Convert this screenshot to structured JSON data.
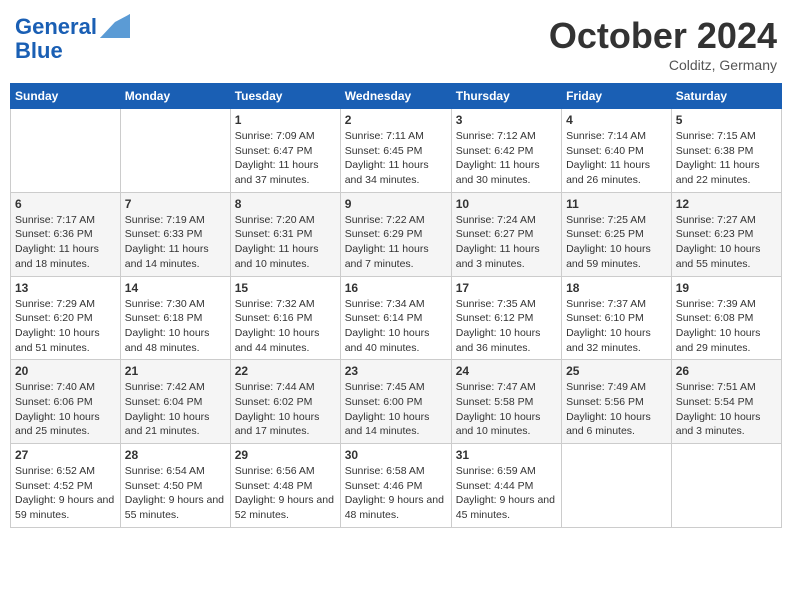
{
  "header": {
    "logo_line1": "General",
    "logo_line2": "Blue",
    "month": "October 2024",
    "location": "Colditz, Germany"
  },
  "weekdays": [
    "Sunday",
    "Monday",
    "Tuesday",
    "Wednesday",
    "Thursday",
    "Friday",
    "Saturday"
  ],
  "weeks": [
    [
      {
        "day": "",
        "info": ""
      },
      {
        "day": "",
        "info": ""
      },
      {
        "day": "1",
        "info": "Sunrise: 7:09 AM\nSunset: 6:47 PM\nDaylight: 11 hours and 37 minutes."
      },
      {
        "day": "2",
        "info": "Sunrise: 7:11 AM\nSunset: 6:45 PM\nDaylight: 11 hours and 34 minutes."
      },
      {
        "day": "3",
        "info": "Sunrise: 7:12 AM\nSunset: 6:42 PM\nDaylight: 11 hours and 30 minutes."
      },
      {
        "day": "4",
        "info": "Sunrise: 7:14 AM\nSunset: 6:40 PM\nDaylight: 11 hours and 26 minutes."
      },
      {
        "day": "5",
        "info": "Sunrise: 7:15 AM\nSunset: 6:38 PM\nDaylight: 11 hours and 22 minutes."
      }
    ],
    [
      {
        "day": "6",
        "info": "Sunrise: 7:17 AM\nSunset: 6:36 PM\nDaylight: 11 hours and 18 minutes."
      },
      {
        "day": "7",
        "info": "Sunrise: 7:19 AM\nSunset: 6:33 PM\nDaylight: 11 hours and 14 minutes."
      },
      {
        "day": "8",
        "info": "Sunrise: 7:20 AM\nSunset: 6:31 PM\nDaylight: 11 hours and 10 minutes."
      },
      {
        "day": "9",
        "info": "Sunrise: 7:22 AM\nSunset: 6:29 PM\nDaylight: 11 hours and 7 minutes."
      },
      {
        "day": "10",
        "info": "Sunrise: 7:24 AM\nSunset: 6:27 PM\nDaylight: 11 hours and 3 minutes."
      },
      {
        "day": "11",
        "info": "Sunrise: 7:25 AM\nSunset: 6:25 PM\nDaylight: 10 hours and 59 minutes."
      },
      {
        "day": "12",
        "info": "Sunrise: 7:27 AM\nSunset: 6:23 PM\nDaylight: 10 hours and 55 minutes."
      }
    ],
    [
      {
        "day": "13",
        "info": "Sunrise: 7:29 AM\nSunset: 6:20 PM\nDaylight: 10 hours and 51 minutes."
      },
      {
        "day": "14",
        "info": "Sunrise: 7:30 AM\nSunset: 6:18 PM\nDaylight: 10 hours and 48 minutes."
      },
      {
        "day": "15",
        "info": "Sunrise: 7:32 AM\nSunset: 6:16 PM\nDaylight: 10 hours and 44 minutes."
      },
      {
        "day": "16",
        "info": "Sunrise: 7:34 AM\nSunset: 6:14 PM\nDaylight: 10 hours and 40 minutes."
      },
      {
        "day": "17",
        "info": "Sunrise: 7:35 AM\nSunset: 6:12 PM\nDaylight: 10 hours and 36 minutes."
      },
      {
        "day": "18",
        "info": "Sunrise: 7:37 AM\nSunset: 6:10 PM\nDaylight: 10 hours and 32 minutes."
      },
      {
        "day": "19",
        "info": "Sunrise: 7:39 AM\nSunset: 6:08 PM\nDaylight: 10 hours and 29 minutes."
      }
    ],
    [
      {
        "day": "20",
        "info": "Sunrise: 7:40 AM\nSunset: 6:06 PM\nDaylight: 10 hours and 25 minutes."
      },
      {
        "day": "21",
        "info": "Sunrise: 7:42 AM\nSunset: 6:04 PM\nDaylight: 10 hours and 21 minutes."
      },
      {
        "day": "22",
        "info": "Sunrise: 7:44 AM\nSunset: 6:02 PM\nDaylight: 10 hours and 17 minutes."
      },
      {
        "day": "23",
        "info": "Sunrise: 7:45 AM\nSunset: 6:00 PM\nDaylight: 10 hours and 14 minutes."
      },
      {
        "day": "24",
        "info": "Sunrise: 7:47 AM\nSunset: 5:58 PM\nDaylight: 10 hours and 10 minutes."
      },
      {
        "day": "25",
        "info": "Sunrise: 7:49 AM\nSunset: 5:56 PM\nDaylight: 10 hours and 6 minutes."
      },
      {
        "day": "26",
        "info": "Sunrise: 7:51 AM\nSunset: 5:54 PM\nDaylight: 10 hours and 3 minutes."
      }
    ],
    [
      {
        "day": "27",
        "info": "Sunrise: 6:52 AM\nSunset: 4:52 PM\nDaylight: 9 hours and 59 minutes."
      },
      {
        "day": "28",
        "info": "Sunrise: 6:54 AM\nSunset: 4:50 PM\nDaylight: 9 hours and 55 minutes."
      },
      {
        "day": "29",
        "info": "Sunrise: 6:56 AM\nSunset: 4:48 PM\nDaylight: 9 hours and 52 minutes."
      },
      {
        "day": "30",
        "info": "Sunrise: 6:58 AM\nSunset: 4:46 PM\nDaylight: 9 hours and 48 minutes."
      },
      {
        "day": "31",
        "info": "Sunrise: 6:59 AM\nSunset: 4:44 PM\nDaylight: 9 hours and 45 minutes."
      },
      {
        "day": "",
        "info": ""
      },
      {
        "day": "",
        "info": ""
      }
    ]
  ]
}
